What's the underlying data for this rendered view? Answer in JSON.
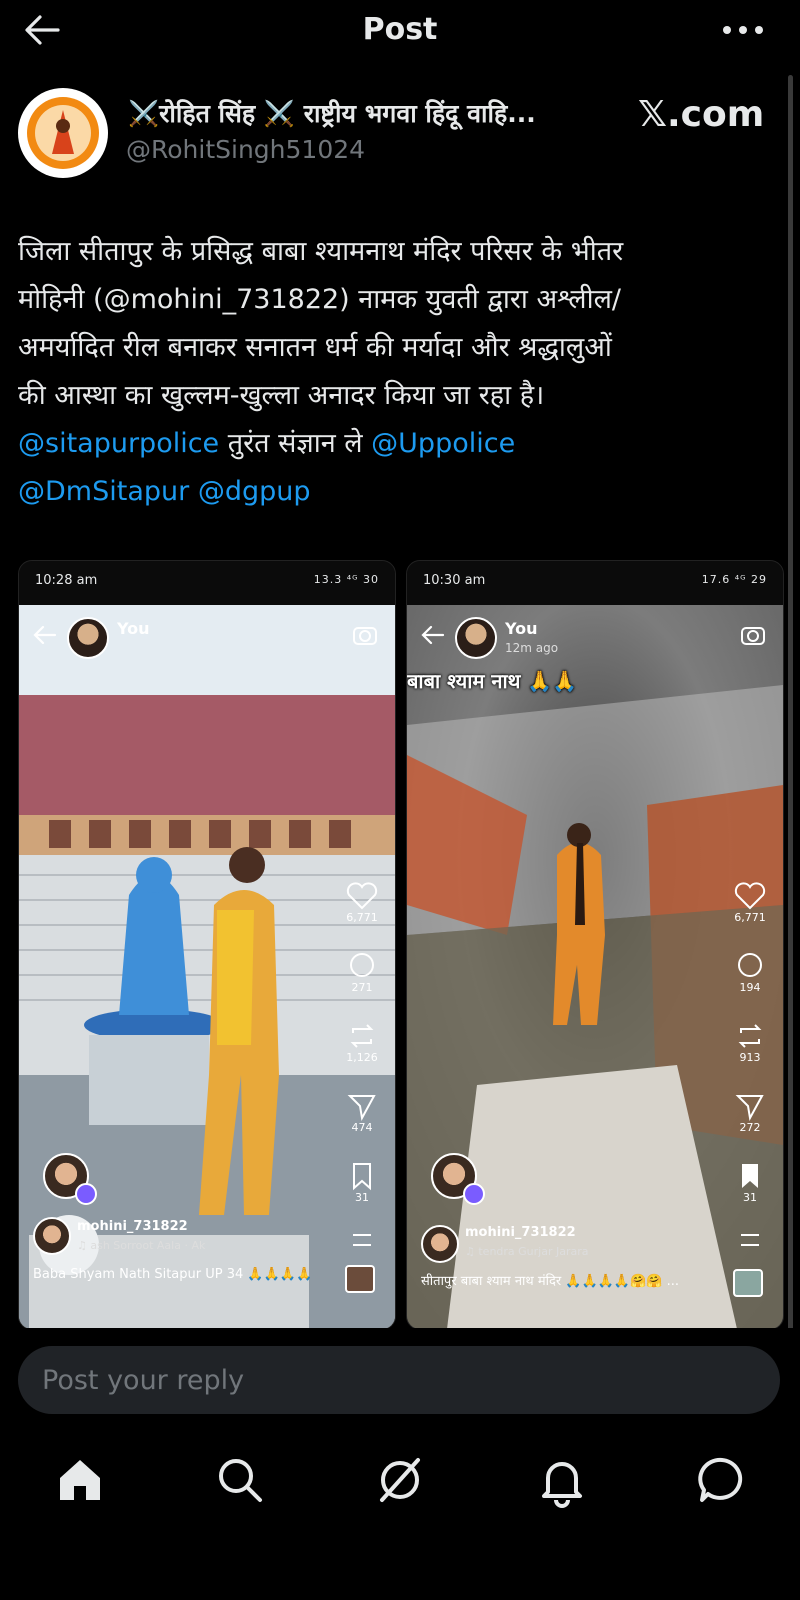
{
  "header": {
    "title": "Post"
  },
  "author": {
    "name": "⚔️रोहित सिंह ⚔️ राष्ट्रीय भगवा हिंदू वाहि...",
    "handle": "@RohitSingh51024",
    "site": "𝕏.com"
  },
  "post": {
    "line1": "जिला सीतापुर के प्रसिद्ध बाबा श्यामनाथ मंदिर परिसर के भीतर",
    "line2": "मोहिनी (@mohini_731822) नामक युवती द्वारा अश्लील/",
    "line3": "अमर्यादित रील बनाकर सनातन धर्म की मर्यादा और श्रद्धालुओं",
    "line4": "की आस्था का खुल्लम-खुल्ला अनादर किया जा रहा है।",
    "mention1": "@sitapurpolice",
    "line5_text": " तुरंत संज्ञान ले  ",
    "mention2": "@Uppolice",
    "mention3": "@DmSitapur",
    "mention4": "@dgpup"
  },
  "media": [
    {
      "time": "10:28 am",
      "status_icons": "13.3 ⁴ᴳ 30",
      "you_label": "You",
      "likes": "6,771",
      "comments": "271",
      "reposts": "1,126",
      "shares": "474",
      "saves": "31",
      "username": "mohini_731822",
      "audio": "♫ ash Sorroot Aala · Ak",
      "caption": "Baba Shyam Nath Sitapur UP 34 🙏🙏🙏🙏"
    },
    {
      "time": "10:30 am",
      "status_icons": "17.6 ⁴ᴳ 29",
      "you_label": "You",
      "ago": "12m ago",
      "overlay": "बाबा श्याम नाथ 🙏🙏",
      "likes": "6,771",
      "comments": "194",
      "reposts": "913",
      "shares": "272",
      "saves": "31",
      "username": "mohini_731822",
      "audio": "♫ tendra Gurjar Jarara",
      "caption": "सीतापुर बाबा श्याम नाथ मंदिर 🙏🙏🙏🙏🤗🤗 ..."
    }
  ],
  "reply": {
    "placeholder": "Post your reply"
  },
  "nav": [
    "home",
    "search",
    "grok",
    "notifications",
    "messages"
  ]
}
